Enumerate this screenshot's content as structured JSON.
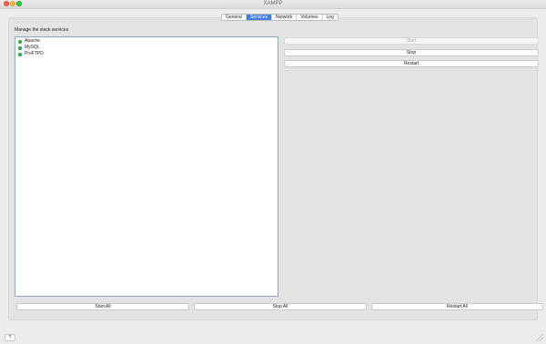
{
  "window": {
    "title": "XAMPP"
  },
  "tabs": [
    {
      "label": "General",
      "active": false
    },
    {
      "label": "Services",
      "active": true
    },
    {
      "label": "Network",
      "active": false
    },
    {
      "label": "Volumes",
      "active": false
    },
    {
      "label": "Log",
      "active": false
    }
  ],
  "services_section": {
    "title": "Manage the stack services",
    "items": [
      {
        "label": "Apache",
        "status_color": "#32b94a"
      },
      {
        "label": "MySQL",
        "status_color": "#32b94a"
      },
      {
        "label": "ProFTPD",
        "status_color": "#32b94a"
      }
    ]
  },
  "actions": {
    "start_label": "Start",
    "stop_label": "Stop",
    "restart_label": "Restart"
  },
  "bottom_actions": {
    "start_all_label": "Start All",
    "stop_all_label": "Stop All",
    "restart_all_label": "Restart All"
  },
  "footer": {
    "help_label": "?"
  },
  "colors": {
    "accent": "#3f7ee0",
    "running": "#32b94a"
  }
}
